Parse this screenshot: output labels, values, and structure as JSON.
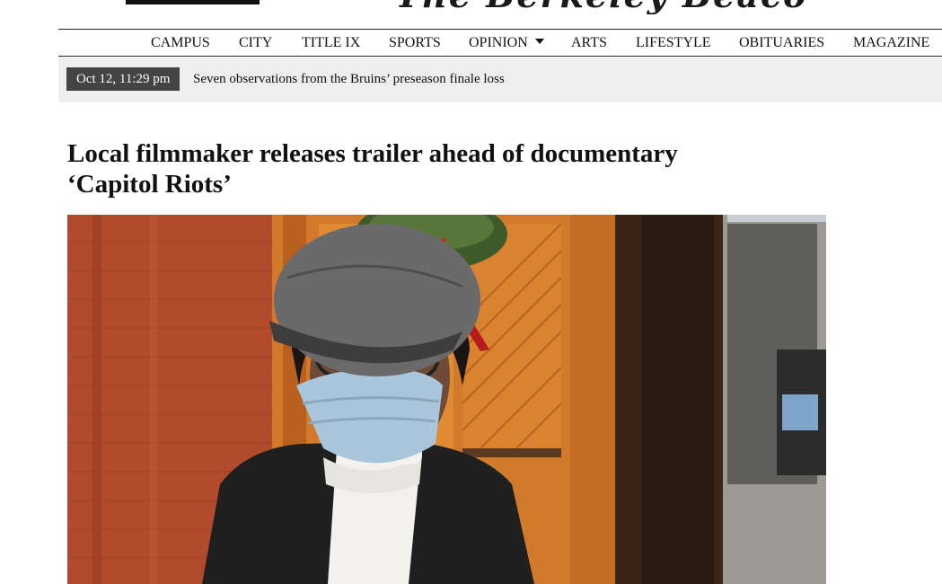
{
  "masthead": {
    "logo_text": "The Berkeley Beacon"
  },
  "nav": {
    "items": [
      {
        "label": "CAMPUS"
      },
      {
        "label": "CITY"
      },
      {
        "label": "TITLE IX"
      },
      {
        "label": "SPORTS"
      },
      {
        "label": "OPINION",
        "has_dropdown": true
      },
      {
        "label": "ARTS"
      },
      {
        "label": "LIFESTYLE"
      },
      {
        "label": "OBITUARIES"
      },
      {
        "label": "MAGAZINE"
      }
    ]
  },
  "ticker": {
    "timestamp": "Oct 12, 11:29 pm",
    "headline": "Seven observations from the Bruins’ preseason finale loss"
  },
  "article": {
    "title": "Local filmmaker releases trailer ahead of documentary ‘Capitol Riots’"
  },
  "hero_image": {
    "subject": "person in grey cap and face mask in front of a wooden door with a wreath"
  },
  "colors": {
    "ticker_bg": "#eeeeee",
    "timestamp_bg": "#444444",
    "brick": "#b5472a",
    "door": "#c9742a"
  }
}
